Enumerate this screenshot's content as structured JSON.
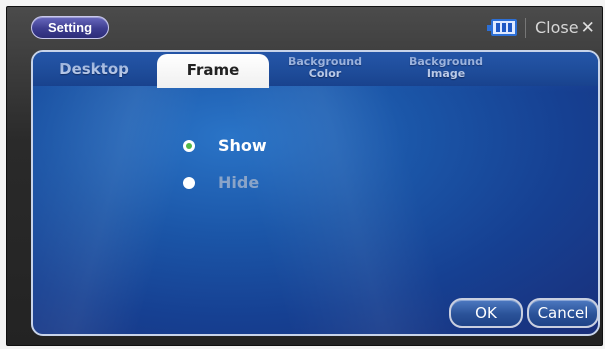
{
  "header": {
    "title": "Setting",
    "close_label": "Close",
    "close_glyph": "✕",
    "battery_icon": "battery-icon"
  },
  "tabs": [
    {
      "label": "Desktop",
      "active": false
    },
    {
      "label": "Frame",
      "active": true
    },
    {
      "line1": "Background",
      "line2": "Color",
      "active": false
    },
    {
      "line1": "Background",
      "line2": "Image",
      "active": false
    }
  ],
  "options": [
    {
      "label": "Show",
      "selected": true
    },
    {
      "label": "Hide",
      "selected": false
    }
  ],
  "buttons": {
    "ok": "OK",
    "cancel": "Cancel"
  },
  "colors": {
    "accent": "#2a5298",
    "selected_dot": "#52b848",
    "disabled_text": "#8aa4c8"
  }
}
